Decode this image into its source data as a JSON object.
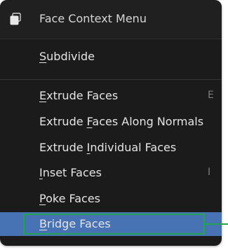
{
  "menu": {
    "title": "Face Context Menu",
    "icon": "mesh-face-icon",
    "items": [
      {
        "pre": "",
        "ul": "S",
        "post": "ubdivide",
        "shortcut": ""
      },
      {
        "pre": "",
        "ul": "E",
        "post": "xtrude Faces",
        "shortcut": "E"
      },
      {
        "pre": "Extrude ",
        "ul": "F",
        "post": "aces Along Normals",
        "shortcut": ""
      },
      {
        "pre": "Extrude ",
        "ul": "I",
        "post": "ndividual Faces",
        "shortcut": ""
      },
      {
        "pre": "",
        "ul": "I",
        "post": "nset Faces",
        "shortcut": "I"
      },
      {
        "pre": "",
        "ul": "P",
        "post": "oke Faces",
        "shortcut": ""
      },
      {
        "pre": "",
        "ul": "B",
        "post": "ridge Faces",
        "shortcut": ""
      }
    ],
    "active_item": "Bridge Faces"
  },
  "colors": {
    "menu_background": "#1b1b1b",
    "text": "#e4e4e4",
    "shortcut_text": "#7e7e7e",
    "active_background": "#4772b3",
    "annotation_highlight": "#22a34f"
  }
}
